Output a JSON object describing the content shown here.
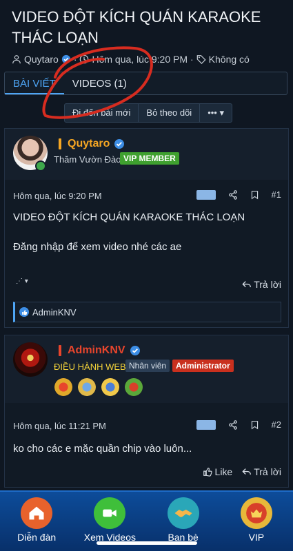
{
  "thread": {
    "title": "VIDEO ĐỘT KÍCH QUÁN KARAOKE THÁC LOẠN",
    "author": "Quytaro",
    "date": "Hôm qua, lúc 9:20 PM",
    "separator": "·",
    "tags": "Không có"
  },
  "tabs": [
    {
      "label": "BÀI VIẾT",
      "active": true
    },
    {
      "label": "VIDEOS (1)",
      "active": false
    }
  ],
  "actions": {
    "goto_new": "Đi đến bài mới",
    "unwatch": "Bỏ theo dõi",
    "more": "•••"
  },
  "posts": [
    {
      "username": "Quytaro",
      "user_title": "Thăm Vườn Đào",
      "badge": "VIP MEMBER",
      "date": "Hôm qua, lúc 9:20 PM",
      "number": "#1",
      "title_line": "VIDEO ĐỘT KÍCH QUÁN KARAOKE THÁC LOẠN",
      "body": "Đăng nhập để xem video nhé các ae",
      "reply_label": "Trả lời",
      "reaction_user": "AdminKNV"
    },
    {
      "username": "AdminKNV",
      "user_title": "ĐIỀU HÀNH WEB",
      "badge_staff": "Nhân viên",
      "badge_admin": "Administrator",
      "date": "Hôm qua, lúc 11:21 PM",
      "number": "#2",
      "body": "ko cho các e mặc quần chip vào luôn...",
      "like_label": "Like",
      "reply_label": "Trả lời"
    }
  ],
  "bottom_nav": [
    {
      "label": "Diễn đàn",
      "icon": "home-icon",
      "color": "#e8622c"
    },
    {
      "label": "Xem Videos",
      "icon": "video-camera-icon",
      "color": "#3fbf3a"
    },
    {
      "label": "Bạn bè",
      "icon": "handshake-icon",
      "color": "#2aa7b8"
    },
    {
      "label": "VIP",
      "icon": "vip-crown-icon",
      "color": "#c9411e"
    }
  ],
  "colors": {
    "background": "#0f1722",
    "accent_blue": "#4ea5f5",
    "username_gold": "#f5a623",
    "username_red": "#e8452c",
    "vip_badge": "#3fa02f",
    "admin_badge": "#c9301e"
  }
}
